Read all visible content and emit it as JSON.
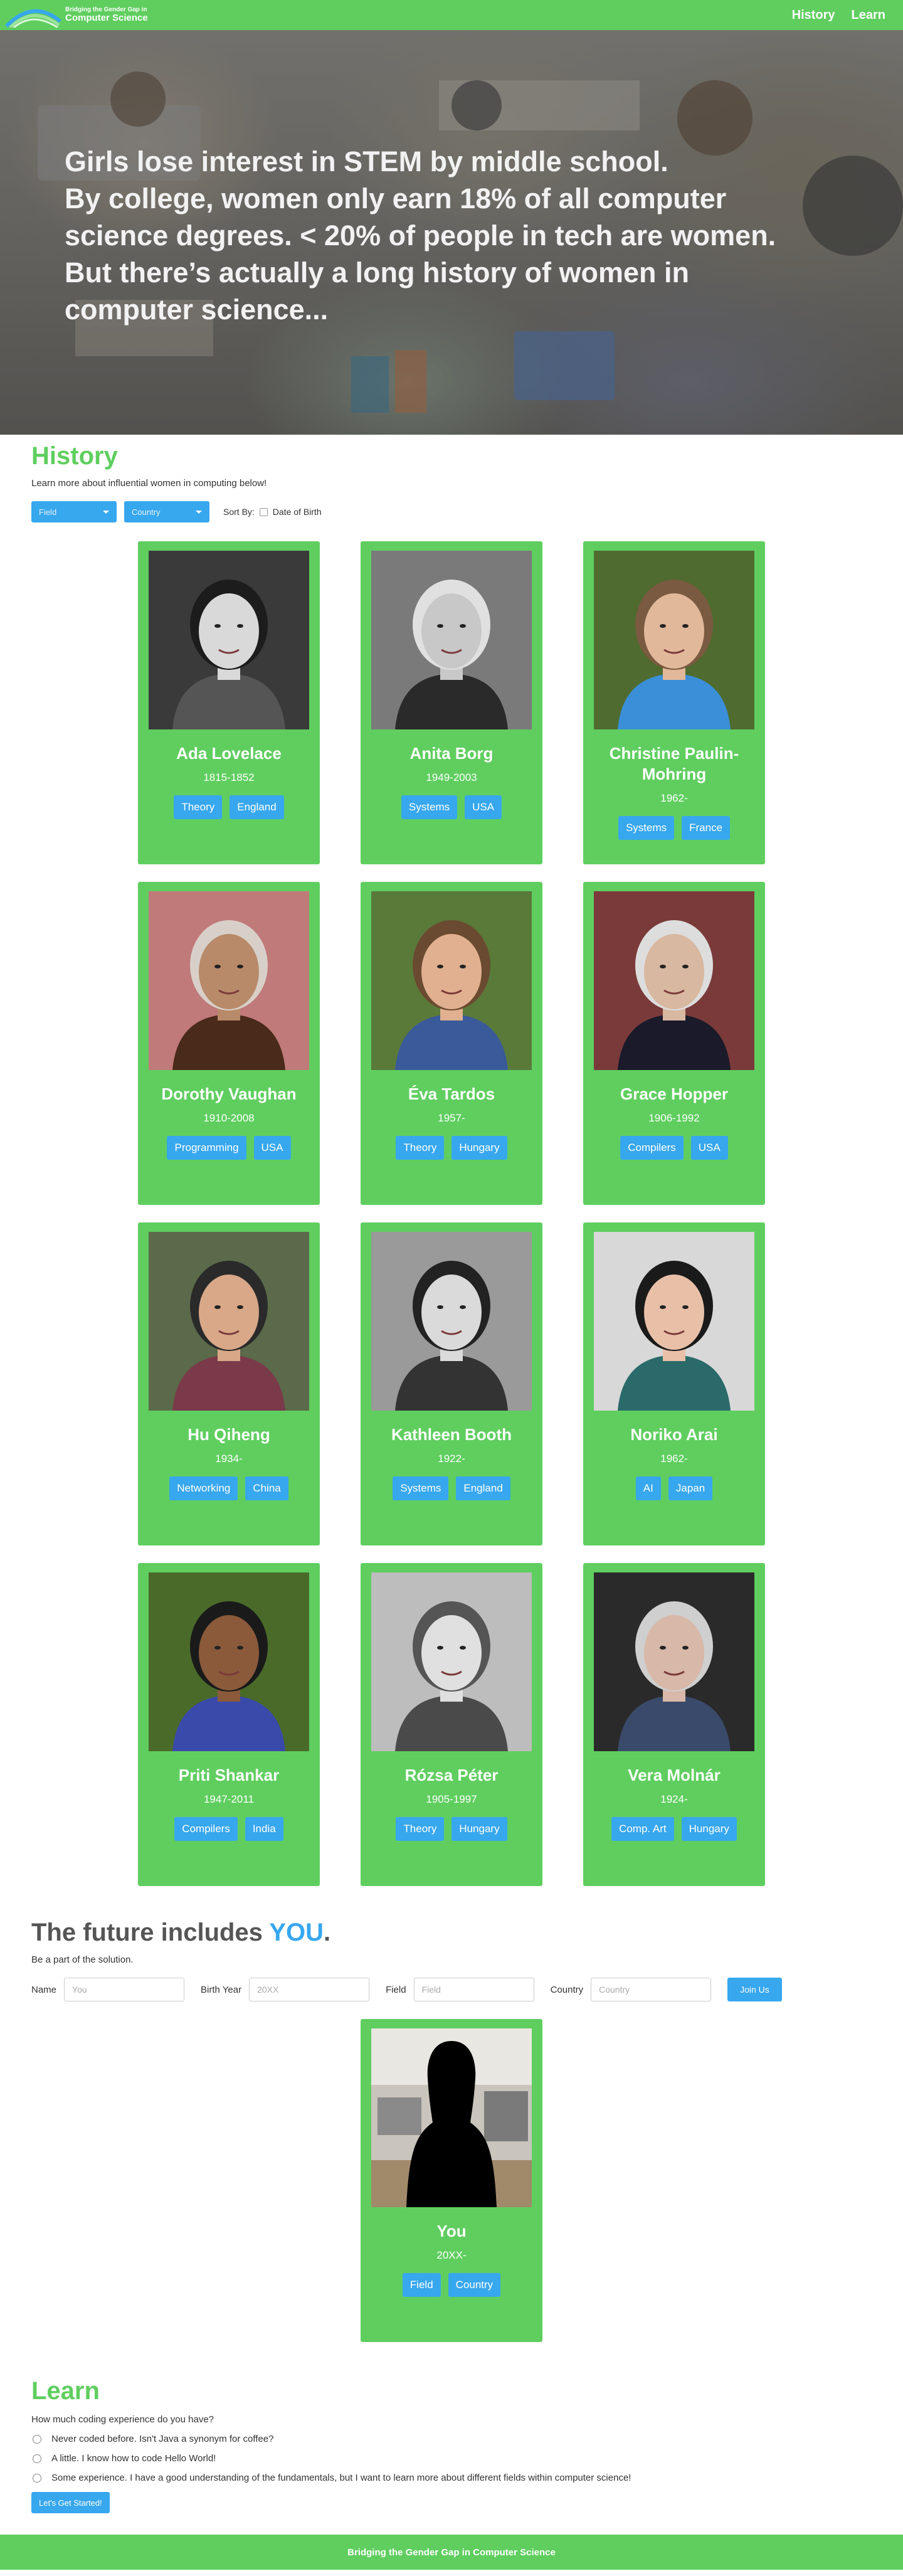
{
  "nav": {
    "brand_top": "Bridging the Gender Gap in",
    "brand_bottom": "Computer Science",
    "links": [
      "History",
      "Learn"
    ]
  },
  "hero": {
    "lines": [
      "Girls lose interest in STEM by middle school.",
      "By college, women only earn 18% of all computer",
      "science degrees. < 20% of people in tech are women.",
      "But there’s actually a long history of women in",
      "computer science..."
    ]
  },
  "history": {
    "title": "History",
    "subtitle": "Learn more about influential women in computing below!",
    "field_label": "Field",
    "country_label": "Country",
    "sort_by": "Sort By:",
    "sort_option": "Date of Birth"
  },
  "people": [
    {
      "name": "Ada Lovelace",
      "years": "1815-1852",
      "field": "Theory",
      "country": "England",
      "bg": "#3a3a3a",
      "skin": "#d9d9d9",
      "hair": "#1c1c1c",
      "shirt": "#555555"
    },
    {
      "name": "Anita Borg",
      "years": "1949-2003",
      "field": "Systems",
      "country": "USA",
      "bg": "#7a7a7a",
      "skin": "#c8c8c8",
      "hair": "#e0e0e0",
      "shirt": "#2a2a2a"
    },
    {
      "name": "Christine Paulin-Mohring",
      "years": "1962-",
      "field": "Systems",
      "country": "France",
      "bg": "#4f6b2f",
      "skin": "#e2b89a",
      "hair": "#7a5a40",
      "shirt": "#3a8fd8"
    },
    {
      "name": "Dorothy Vaughan",
      "years": "1910-2008",
      "field": "Programming",
      "country": "USA",
      "bg": "#c07a7a",
      "skin": "#b88a6a",
      "hair": "#d8d0c8",
      "shirt": "#4a2a1a"
    },
    {
      "name": "Éva Tardos",
      "years": "1957-",
      "field": "Theory",
      "country": "Hungary",
      "bg": "#5a7a3a",
      "skin": "#e0b090",
      "hair": "#6a4a30",
      "shirt": "#3a5a9a"
    },
    {
      "name": "Grace Hopper",
      "years": "1906-1992",
      "field": "Compilers",
      "country": "USA",
      "bg": "#7a3a3a",
      "skin": "#d8b8a0",
      "hair": "#dddddd",
      "shirt": "#1a1a2a"
    },
    {
      "name": "Hu Qiheng",
      "years": "1934-",
      "field": "Networking",
      "country": "China",
      "bg": "#5a6a4a",
      "skin": "#d8a888",
      "hair": "#2a2a2a",
      "shirt": "#7a3a4a"
    },
    {
      "name": "Kathleen Booth",
      "years": "1922-",
      "field": "Systems",
      "country": "England",
      "bg": "#9a9a9a",
      "skin": "#dadada",
      "hair": "#222222",
      "shirt": "#333333"
    },
    {
      "name": "Noriko Arai",
      "years": "1962-",
      "field": "AI",
      "country": "Japan",
      "bg": "#d8d8d8",
      "skin": "#e8c0a8",
      "hair": "#1a1a1a",
      "shirt": "#2a6a6a"
    },
    {
      "name": "Priti Shankar",
      "years": "1947-2011",
      "field": "Compilers",
      "country": "India",
      "bg": "#4a6a2a",
      "skin": "#8a5a3a",
      "hair": "#1a1a1a",
      "shirt": "#3a4aaa"
    },
    {
      "name": "Rózsa Péter",
      "years": "1905-1997",
      "field": "Theory",
      "country": "Hungary",
      "bg": "#bdbdbd",
      "skin": "#e0e0e0",
      "hair": "#555555",
      "shirt": "#4a4a4a"
    },
    {
      "name": "Vera Molnár",
      "years": "1924-",
      "field": "Comp. Art",
      "country": "Hungary",
      "bg": "#2a2a2a",
      "skin": "#d8b8a8",
      "hair": "#cfcfcf",
      "shirt": "#3a4a6a"
    }
  ],
  "future": {
    "title_prefix": "The future includes ",
    "title_you": "YOU",
    "title_suffix": ".",
    "subtitle": "Be a part of the solution.",
    "name_label": "Name",
    "name_placeholder": "You",
    "birth_label": "Birth Year",
    "birth_placeholder": "20XX",
    "field_label": "Field",
    "field_placeholder": "Field",
    "country_label": "Country",
    "country_placeholder": "Country",
    "join_label": "Join Us",
    "card": {
      "name": "You",
      "years": "20XX-",
      "field": "Field",
      "country": "Country"
    }
  },
  "learn": {
    "title": "Learn",
    "question": "How much coding experience do you have?",
    "options": [
      "Never coded before. Isn't Java a synonym for coffee?",
      "A little. I know how to code Hello World!",
      "Some experience. I have a good understanding of the fundamentals, but I want to learn more about different fields within computer science!"
    ],
    "button": "Let's Get Started!"
  },
  "footer": {
    "text": "Bridging the Gender Gap in Computer Science"
  },
  "colors": {
    "green": "#5fce5f",
    "blue": "#37a7ee"
  }
}
